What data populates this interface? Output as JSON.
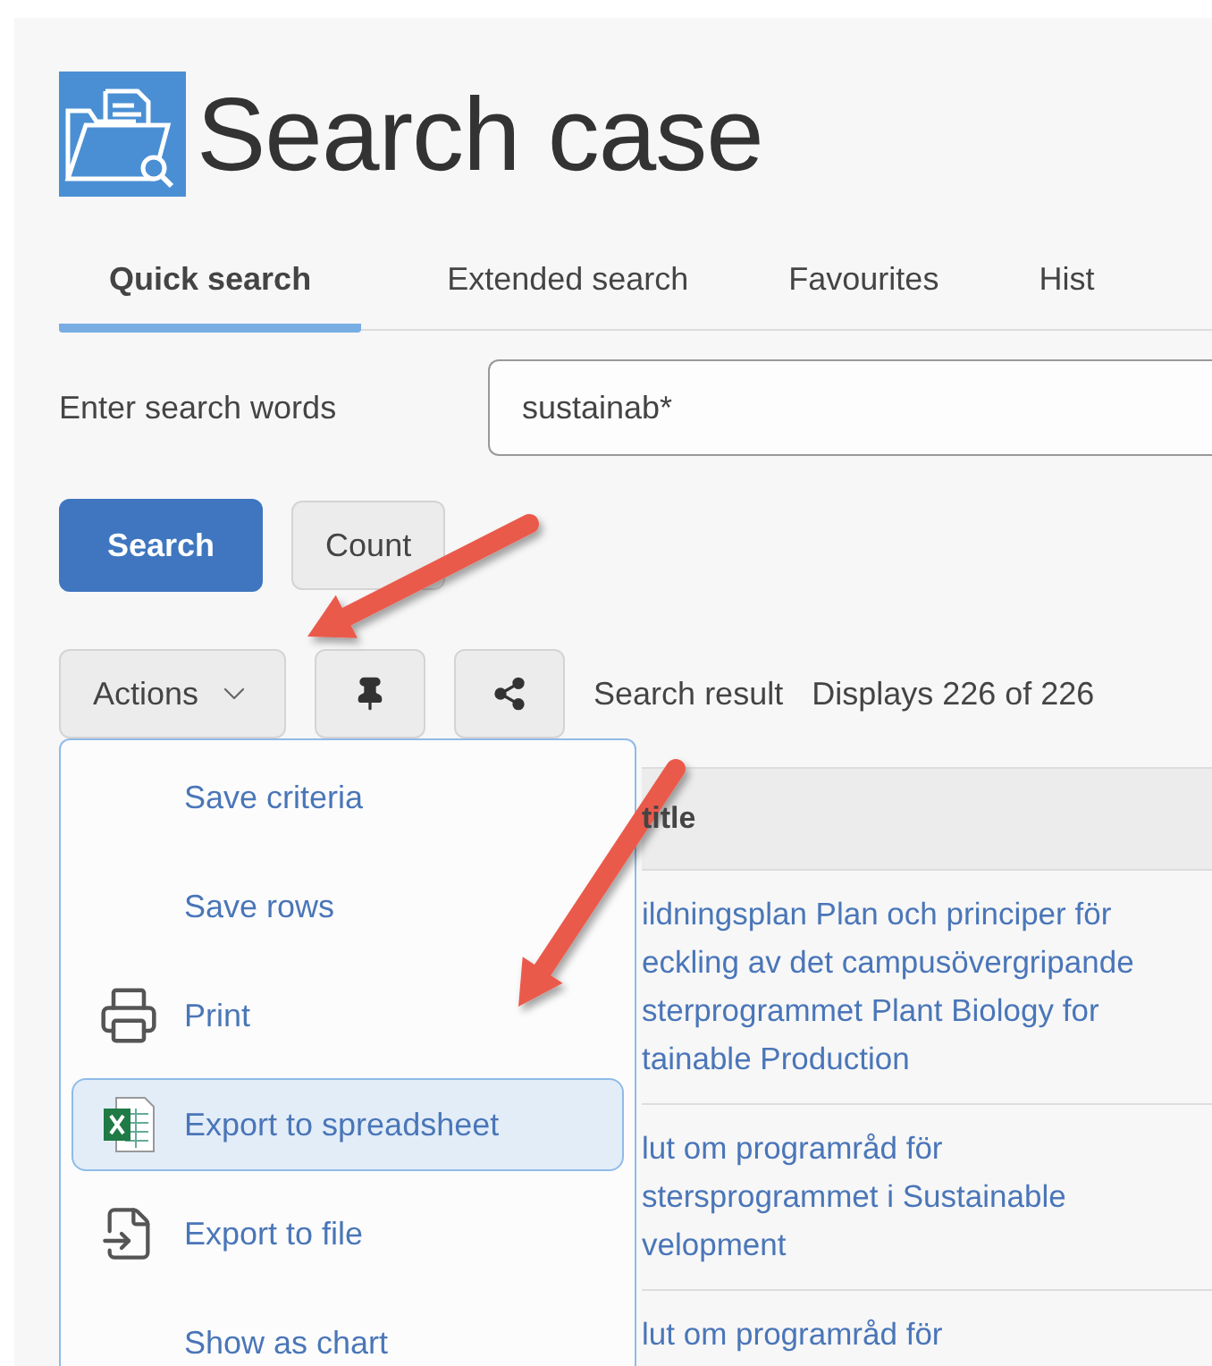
{
  "page": {
    "title": "Search case"
  },
  "tabs": [
    {
      "label": "Quick search",
      "selected": true
    },
    {
      "label": "Extended search",
      "selected": false
    },
    {
      "label": "Favourites",
      "selected": false
    },
    {
      "label": "Hist",
      "selected": false
    }
  ],
  "search": {
    "label": "Enter search words",
    "value": "sustainab*"
  },
  "buttons": [
    {
      "label": "Search",
      "kind": "primary"
    },
    {
      "label": "Count",
      "kind": "secondary"
    }
  ],
  "actions": {
    "label": "Actions",
    "expanded": true
  },
  "result": {
    "label": "Search result",
    "count": "Displays 226 of 226"
  },
  "menu": [
    {
      "label": "Save criteria",
      "kind": "plain",
      "selected": false
    },
    {
      "label": "Save rows",
      "kind": "plain",
      "selected": false
    },
    {
      "label": "Print",
      "kind": "print",
      "selected": false
    },
    {
      "label": "Export to spreadsheet",
      "kind": "spreadsheet",
      "selected": true
    },
    {
      "label": "Export to file",
      "kind": "file",
      "selected": false
    },
    {
      "label": "Show as chart",
      "kind": "plain",
      "selected": false
    }
  ],
  "table": {
    "columns": [
      "title"
    ],
    "rows": [
      {
        "lines": [
          "ildningsplan Plan och principer för",
          "eckling av det campusövergripande",
          "sterprogrammet Plant Biology for",
          "tainable Production"
        ]
      },
      {
        "lines": [
          "lut om programråd för",
          "stersprogrammet i Sustainable",
          "velopment"
        ]
      },
      {
        "lines": [
          "lut om programråd för"
        ]
      }
    ]
  }
}
